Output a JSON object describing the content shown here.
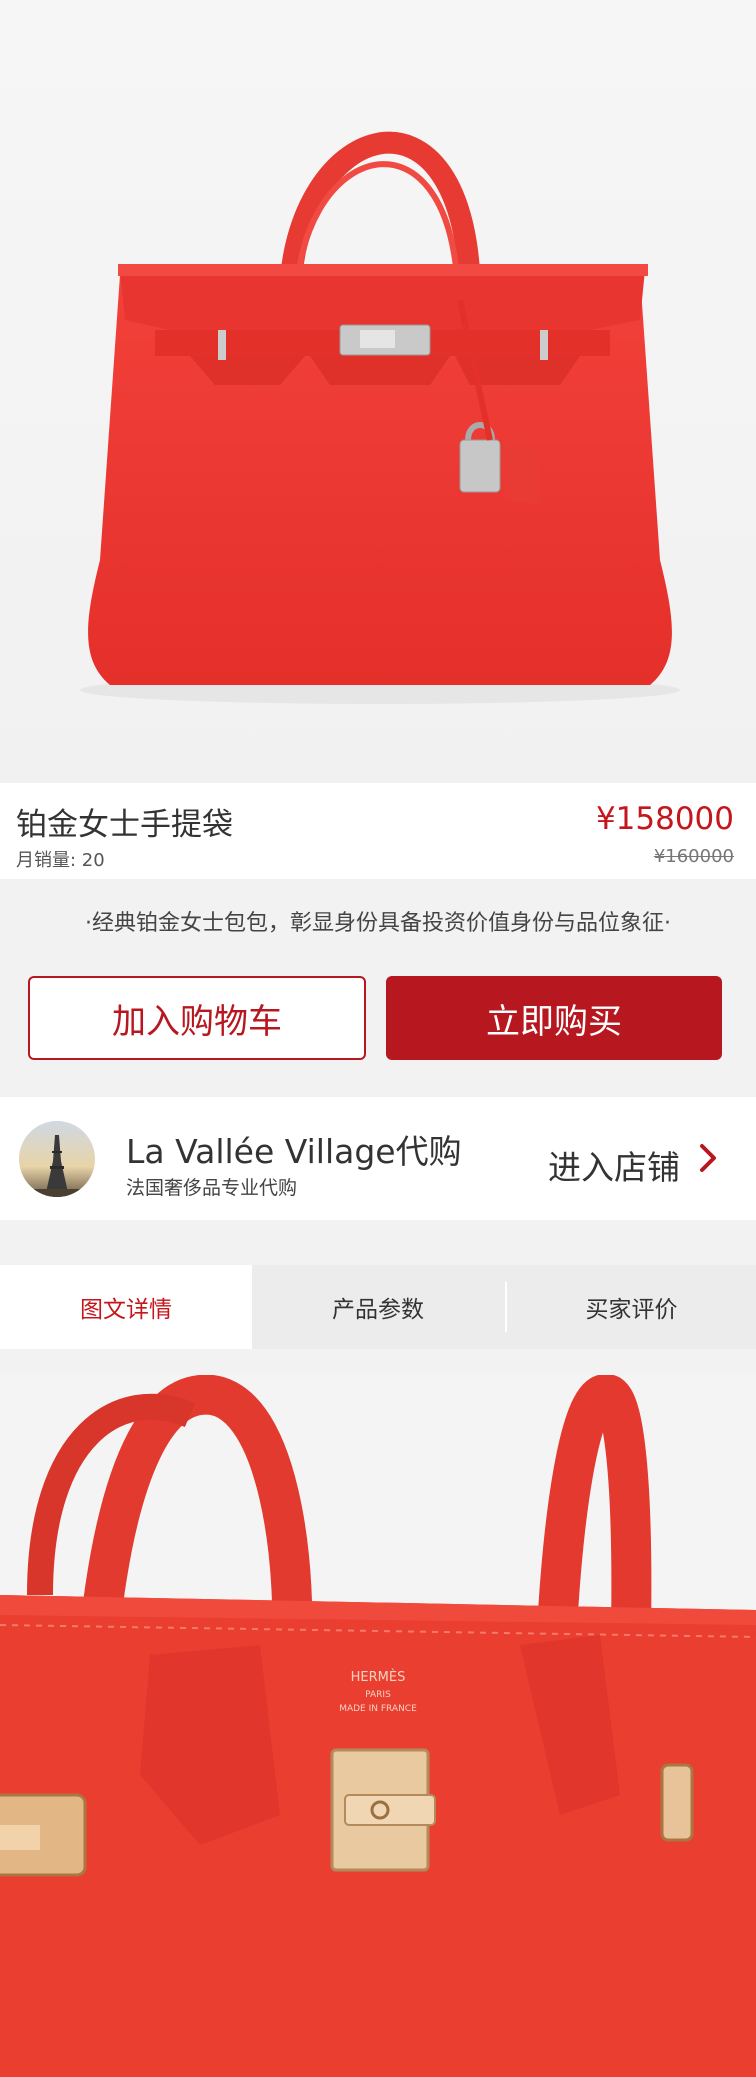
{
  "product": {
    "title": "铂金女士手提袋",
    "sales": "月销量: 20",
    "price": "¥158000",
    "original_price": "¥160000",
    "slogan": "·经典铂金女士包包，彰显身份具备投资价值身份与品位象征·"
  },
  "actions": {
    "add_to_cart": "加入购物车",
    "buy_now": "立即购买"
  },
  "shop": {
    "name": "La Vallée Village代购",
    "description": "法国奢侈品专业代购",
    "enter_label": "进入店铺"
  },
  "tabs": [
    {
      "label": "图文详情",
      "active": true
    },
    {
      "label": "产品参数",
      "active": false
    },
    {
      "label": "买家评价",
      "active": false
    }
  ],
  "detail_image": {
    "brand_text": "HERMÈS",
    "brand_line2": "PARIS",
    "brand_line3": "MADE IN FRANCE"
  },
  "colors": {
    "accent": "#b7171f",
    "price": "#c5161c",
    "bag_red": "#ee3a33"
  }
}
